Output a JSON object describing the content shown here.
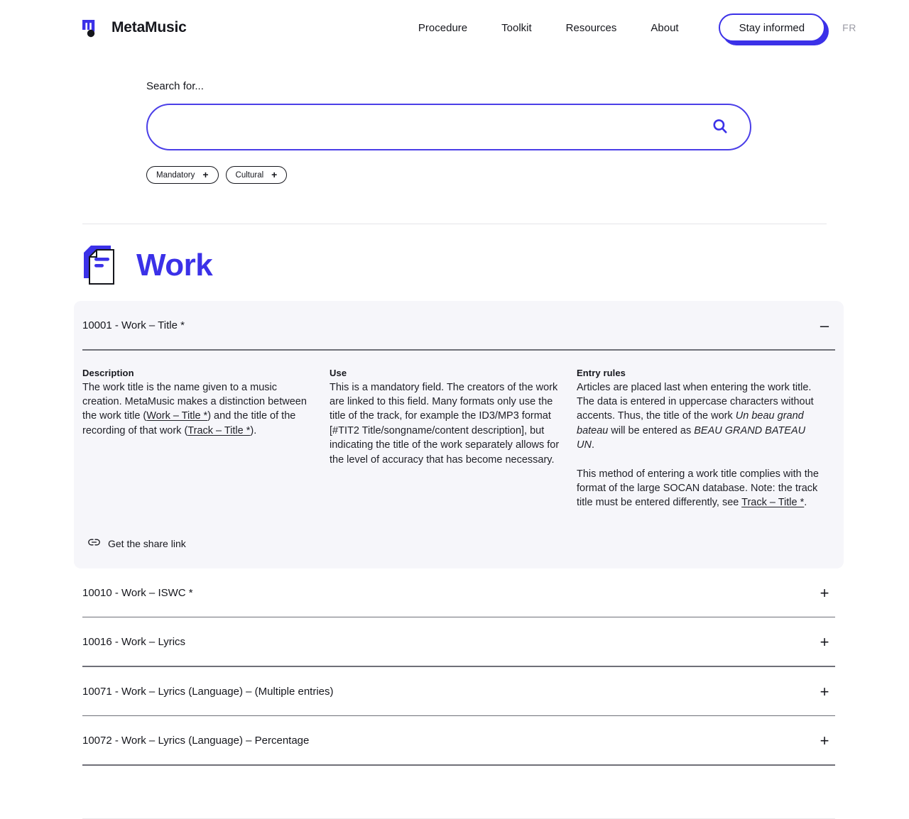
{
  "brand": {
    "name": "MetaMusic",
    "logo_icon": "metamusic-note-logo"
  },
  "nav": {
    "links": [
      {
        "label": "Procedure"
      },
      {
        "label": "Toolkit"
      },
      {
        "label": "Resources"
      },
      {
        "label": "About"
      }
    ],
    "cta_label": "Stay informed",
    "lang_label": "FR"
  },
  "search": {
    "label": "Search for...",
    "value": "",
    "placeholder": "",
    "icon": "search-icon",
    "filters": [
      {
        "label": "Mandatory",
        "action": "+"
      },
      {
        "label": "Cultural",
        "action": "+"
      }
    ]
  },
  "section": {
    "icon": "document-stack-icon",
    "title": "Work"
  },
  "accordion": {
    "items": [
      {
        "title": "10001 - Work – Title *",
        "toggle": "–",
        "open": true,
        "columns": [
          {
            "heading": "Description",
            "paragraphs": [
              "The work title is the name given to a music creation. MetaMusic makes a distinction between the work title (Work – Title *) and the title of the recording of that work (Track – Title *)."
            ]
          },
          {
            "heading": "Use",
            "paragraphs": [
              "This is a mandatory field. The creators of the work are linked to this field. Many formats only use the title of the track, for example the ID3/MP3 format [#TIT2 Title/songname/content description], but indicating the title of the work separately allows for the level of accuracy that has become necessary."
            ]
          },
          {
            "heading": "Entry rules",
            "paragraphs": [
              "Articles are placed last when entering the work title. The data is entered in uppercase characters without accents. Thus, the title of the work Un beau grand bateau will be entered as BEAU GRAND BATEAU UN.",
              "This method of entering a work title complies with the format of the large SOCAN database. Note: the track title must be entered differently, see Track – Title *."
            ]
          }
        ],
        "share_label": "Get the share link",
        "share_icon": "link-icon"
      },
      {
        "title": "10010 - Work – ISWC *",
        "toggle": "+",
        "open": false
      },
      {
        "title": "10016 - Work – Lyrics",
        "toggle": "+",
        "open": false
      },
      {
        "title": "10071 - Work – Lyrics (Language) – (Multiple entries)",
        "toggle": "+",
        "open": false
      },
      {
        "title": "10072 - Work – Lyrics (Language) – Percentage",
        "toggle": "+",
        "open": false
      }
    ]
  },
  "colors": {
    "accent": "#3b31e8",
    "accent_border": "#4b3fe8",
    "panel_bg": "#f6f6fa",
    "text": "#16171d",
    "muted": "#9c9ca6",
    "rule": "#6f7078"
  }
}
